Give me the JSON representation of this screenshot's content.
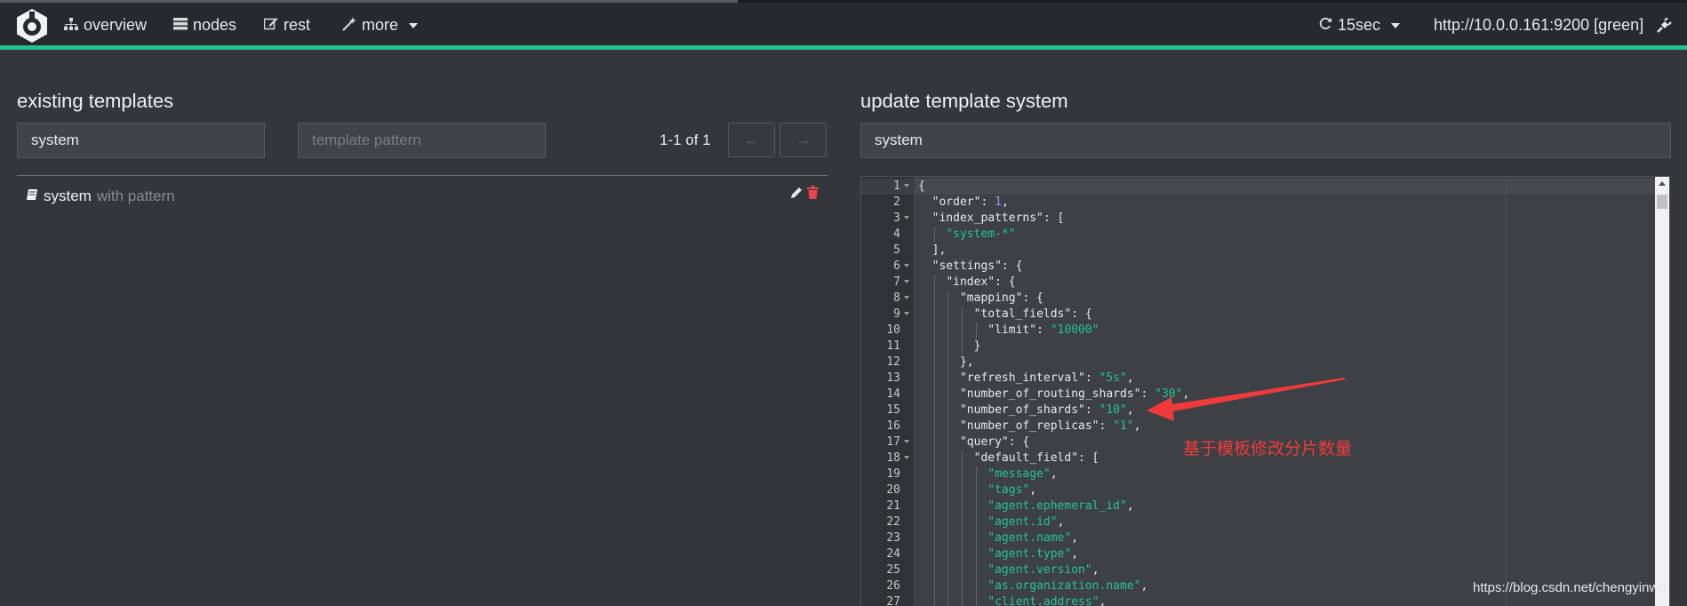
{
  "navbar": {
    "items": [
      {
        "label": "overview",
        "icon": "sitemap-icon"
      },
      {
        "label": "nodes",
        "icon": "server-icon"
      },
      {
        "label": "rest",
        "icon": "edit-icon"
      },
      {
        "label": "more",
        "icon": "magic-wand-icon"
      }
    ],
    "refresh_label": "15sec",
    "cluster_label": "http://10.0.0.161:9200 [green]"
  },
  "existing": {
    "title": "existing templates",
    "filter_value": "system",
    "pattern_placeholder": "template pattern",
    "pagination": "1-1 of 1",
    "prev_label": "←",
    "next_label": "→",
    "templates": [
      {
        "name": "system",
        "suffix": "with pattern"
      }
    ]
  },
  "update": {
    "title": "update template system",
    "name_value": "system"
  },
  "editor": {
    "lines": [
      {
        "n": "1",
        "fold": true,
        "i": 0,
        "t": [
          [
            "p",
            "{"
          ]
        ]
      },
      {
        "n": "2",
        "fold": false,
        "i": 1,
        "t": [
          [
            "p",
            "\"order\": "
          ],
          [
            "n",
            "1"
          ],
          [
            "p",
            ","
          ]
        ]
      },
      {
        "n": "3",
        "fold": true,
        "i": 1,
        "t": [
          [
            "p",
            "\"index_patterns\": ["
          ]
        ]
      },
      {
        "n": "4",
        "fold": false,
        "i": 2,
        "t": [
          [
            "s",
            "\"system-*\""
          ]
        ]
      },
      {
        "n": "5",
        "fold": false,
        "i": 1,
        "t": [
          [
            "p",
            "],"
          ]
        ]
      },
      {
        "n": "6",
        "fold": true,
        "i": 1,
        "t": [
          [
            "p",
            "\"settings\": {"
          ]
        ]
      },
      {
        "n": "7",
        "fold": true,
        "i": 2,
        "t": [
          [
            "p",
            "\"index\": {"
          ]
        ]
      },
      {
        "n": "8",
        "fold": true,
        "i": 3,
        "t": [
          [
            "p",
            "\"mapping\": {"
          ]
        ]
      },
      {
        "n": "9",
        "fold": true,
        "i": 4,
        "t": [
          [
            "p",
            "\"total_fields\": {"
          ]
        ]
      },
      {
        "n": "10",
        "fold": false,
        "i": 5,
        "t": [
          [
            "p",
            "\"limit\": "
          ],
          [
            "s",
            "\"10000\""
          ]
        ]
      },
      {
        "n": "11",
        "fold": false,
        "i": 4,
        "t": [
          [
            "p",
            "}"
          ]
        ]
      },
      {
        "n": "12",
        "fold": false,
        "i": 3,
        "t": [
          [
            "p",
            "},"
          ]
        ]
      },
      {
        "n": "13",
        "fold": false,
        "i": 3,
        "t": [
          [
            "p",
            "\"refresh_interval\": "
          ],
          [
            "s",
            "\"5s\""
          ],
          [
            "p",
            ","
          ]
        ]
      },
      {
        "n": "14",
        "fold": false,
        "i": 3,
        "t": [
          [
            "p",
            "\"number_of_routing_shards\": "
          ],
          [
            "s",
            "\"30\""
          ],
          [
            "p",
            ","
          ]
        ]
      },
      {
        "n": "15",
        "fold": false,
        "i": 3,
        "t": [
          [
            "p",
            "\"number_of_shards\": "
          ],
          [
            "s",
            "\"10\""
          ],
          [
            "p",
            ","
          ]
        ]
      },
      {
        "n": "16",
        "fold": false,
        "i": 3,
        "t": [
          [
            "p",
            "\"number_of_replicas\": "
          ],
          [
            "s",
            "\"1\""
          ],
          [
            "p",
            ","
          ]
        ]
      },
      {
        "n": "17",
        "fold": true,
        "i": 3,
        "t": [
          [
            "p",
            "\"query\": {"
          ]
        ]
      },
      {
        "n": "18",
        "fold": true,
        "i": 4,
        "t": [
          [
            "p",
            "\"default_field\": ["
          ]
        ]
      },
      {
        "n": "19",
        "fold": false,
        "i": 5,
        "t": [
          [
            "s",
            "\"message\""
          ],
          [
            "p",
            ","
          ]
        ]
      },
      {
        "n": "20",
        "fold": false,
        "i": 5,
        "t": [
          [
            "s",
            "\"tags\""
          ],
          [
            "p",
            ","
          ]
        ]
      },
      {
        "n": "21",
        "fold": false,
        "i": 5,
        "t": [
          [
            "s",
            "\"agent.ephemeral_id\""
          ],
          [
            "p",
            ","
          ]
        ]
      },
      {
        "n": "22",
        "fold": false,
        "i": 5,
        "t": [
          [
            "s",
            "\"agent.id\""
          ],
          [
            "p",
            ","
          ]
        ]
      },
      {
        "n": "23",
        "fold": false,
        "i": 5,
        "t": [
          [
            "s",
            "\"agent.name\""
          ],
          [
            "p",
            ","
          ]
        ]
      },
      {
        "n": "24",
        "fold": false,
        "i": 5,
        "t": [
          [
            "s",
            "\"agent.type\""
          ],
          [
            "p",
            ","
          ]
        ]
      },
      {
        "n": "25",
        "fold": false,
        "i": 5,
        "t": [
          [
            "s",
            "\"agent.version\""
          ],
          [
            "p",
            ","
          ]
        ]
      },
      {
        "n": "26",
        "fold": false,
        "i": 5,
        "t": [
          [
            "s",
            "\"as.organization.name\""
          ],
          [
            "p",
            ","
          ]
        ]
      },
      {
        "n": "27",
        "fold": false,
        "i": 5,
        "t": [
          [
            "s",
            "\"client.address\""
          ],
          [
            "p",
            ","
          ]
        ]
      }
    ]
  },
  "annotation": {
    "text": "基于模板修改分片数量",
    "color": "#f03a3a"
  },
  "watermark": "https://blog.csdn.net/chengyinwu",
  "colors": {
    "accent": "#23c28b",
    "string": "#24c48b",
    "number": "#b08cff",
    "background": "#33373b"
  }
}
